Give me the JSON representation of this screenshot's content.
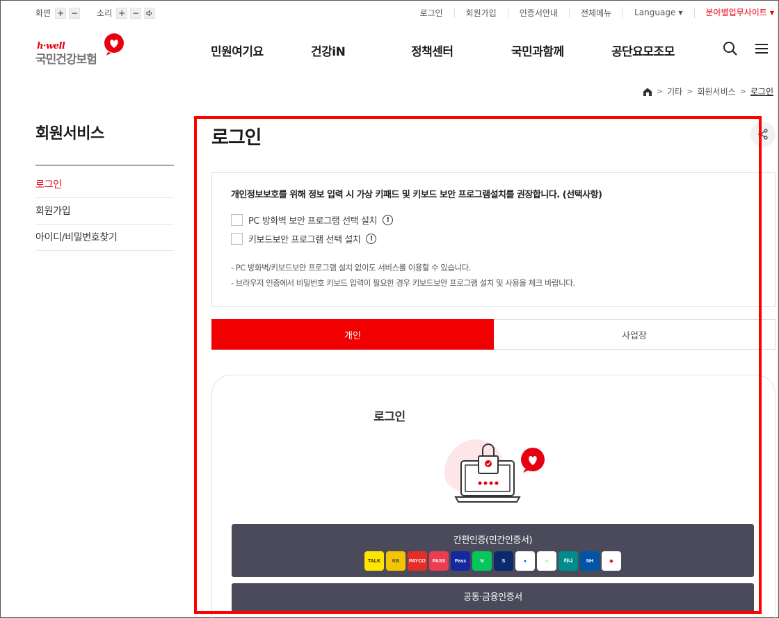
{
  "util": {
    "screen_label": "화면",
    "sound_label": "소리",
    "plus": "+",
    "minus": "−",
    "links": [
      "로그인",
      "회원가입",
      "인증서안내",
      "전체메뉴"
    ],
    "language": "Language",
    "biz_site": "분야별업무사이트"
  },
  "logo": {
    "hwell": "h·well",
    "name": "국민건강보험"
  },
  "gnb": [
    "민원여기요",
    "건강iN",
    "정책센터",
    "국민과함께",
    "공단요모조모"
  ],
  "breadcrumb": [
    "기타",
    "회원서비스",
    "로그인"
  ],
  "lnb": {
    "title": "회원서비스",
    "items": [
      "로그인",
      "회원가입",
      "아이디/비밀번호찾기"
    ]
  },
  "page_title": "로그인",
  "security": {
    "heading": "개인정보보호를 위해 정보 입력 시 가상 키패드 및 키보드 보안 프로그램설치를 권장합니다. (선택사항)",
    "opt1": "PC 방화벽 보안 프로그램 선택 설치",
    "opt2": "키보드보안 프로그램 선택 설치",
    "note1": "-  PC 방화벽/키보드보안 프로그램 설치 없이도 서비스를 이용할 수 있습니다.",
    "note2": "-  브라우저 인증에서 비밀번호 키보드 입력이 필요한 경우 키보드보안 프로그램 설치 및 사용을 체크 바랍니다."
  },
  "tabs": [
    "개인",
    "사업장"
  ],
  "login": {
    "title": "로그인",
    "easy_auth": "간편인증(민간인증서)",
    "cert_auth": "공동·금융인증서"
  },
  "providers": [
    {
      "name": "kakao",
      "label": "TALK",
      "color": "#fee500",
      "fg": "#3c1e1e"
    },
    {
      "name": "kb",
      "label": "KB",
      "color": "#f5c400",
      "fg": "#3c3c3c"
    },
    {
      "name": "payco",
      "label": "PAYCO",
      "color": "#e52d27",
      "fg": "#ffffff"
    },
    {
      "name": "pass",
      "label": "PASS",
      "color": "#ea3d52",
      "fg": "#ffffff"
    },
    {
      "name": "samsung-pass",
      "label": "Pass",
      "color": "#1428a0",
      "fg": "#ffffff"
    },
    {
      "name": "naver",
      "label": "N",
      "color": "#03c75a",
      "fg": "#ffffff"
    },
    {
      "name": "shinhan",
      "label": "S",
      "color": "#0c2a6b",
      "fg": "#ffffff"
    },
    {
      "name": "toss",
      "label": "●",
      "color": "#ffffff",
      "fg": "#0064ff"
    },
    {
      "name": "bank-smile",
      "label": "☺",
      "color": "#ffffff",
      "fg": "#1ec800"
    },
    {
      "name": "hana",
      "label": "하나",
      "color": "#008c8c",
      "fg": "#ffffff"
    },
    {
      "name": "nh",
      "label": "NH",
      "color": "#0056a6",
      "fg": "#ffffff"
    },
    {
      "name": "crosscert",
      "label": "◆",
      "color": "#ffffff",
      "fg": "#d11f26"
    }
  ],
  "colors": {
    "accent": "#f00000",
    "brand_red": "#e60012",
    "button_dark": "#4a4a5a"
  }
}
